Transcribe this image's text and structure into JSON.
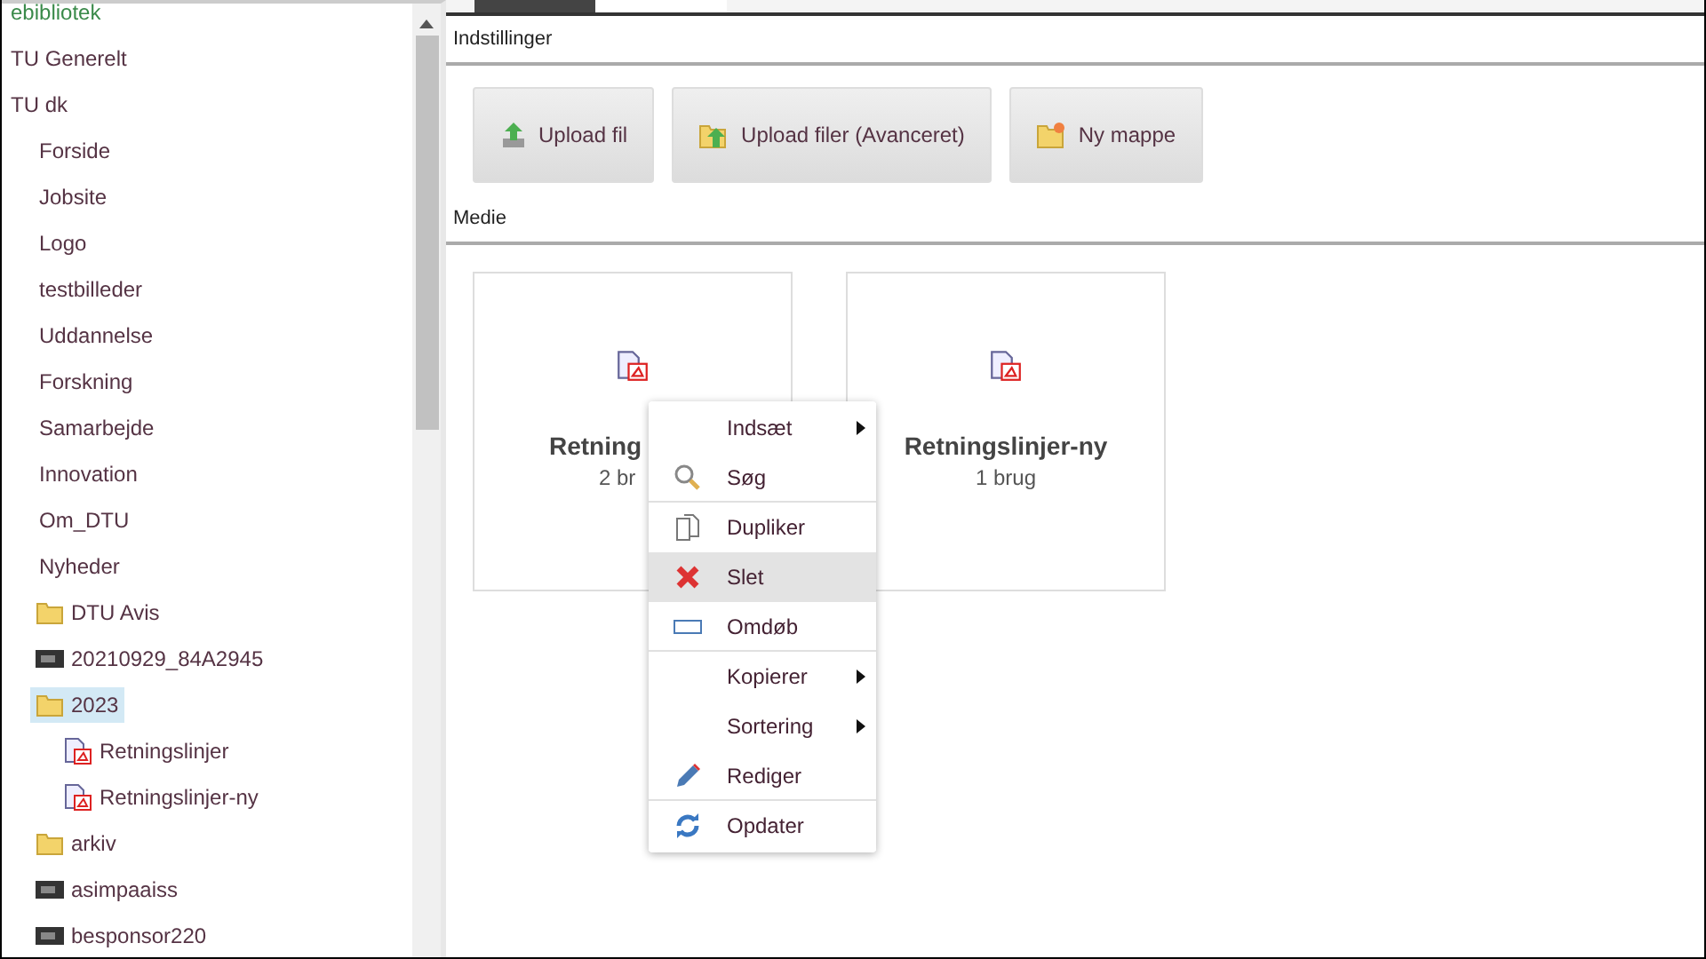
{
  "tree": [
    {
      "label": "ebibliotek",
      "selected": false
    },
    {
      "label": "TU Generelt",
      "selected": false
    },
    {
      "label": "TU dk",
      "selected": false,
      "children": [
        {
          "label": "Forside",
          "selected": false
        },
        {
          "label": "Jobsite",
          "selected": false
        },
        {
          "label": "Logo",
          "selected": false
        },
        {
          "label": "testbilleder",
          "selected": false
        },
        {
          "label": "Uddannelse",
          "selected": false
        },
        {
          "label": "Forskning",
          "selected": false
        },
        {
          "label": "Samarbejde",
          "selected": false
        },
        {
          "label": "Innovation",
          "selected": false
        },
        {
          "label": "Om_DTU",
          "selected": false
        },
        {
          "label": "Nyheder",
          "selected": false
        },
        {
          "label": "DTU Avis",
          "kind": "folder",
          "selected": false
        },
        {
          "label": "20210929_84A2945",
          "kind": "image",
          "selected": false
        },
        {
          "label": "2023",
          "kind": "folder",
          "selected": true,
          "children": [
            {
              "label": "Retningslinjer",
              "kind": "pdf",
              "selected": false
            },
            {
              "label": "Retningslinjer-ny",
              "kind": "pdf",
              "selected": false
            }
          ]
        },
        {
          "label": "arkiv",
          "kind": "folder",
          "selected": false
        },
        {
          "label": "asimpaaiss",
          "kind": "image",
          "selected": false
        },
        {
          "label": "besponsor220",
          "kind": "image",
          "selected": false
        }
      ]
    }
  ],
  "settings_heading": "Indstillinger",
  "buttons": [
    {
      "label": "Upload fil"
    },
    {
      "label": "Upload filer (Avanceret)"
    },
    {
      "label": "Ny mappe"
    }
  ],
  "media_heading": "Medie",
  "media": [
    {
      "title": "Retning",
      "usage": "2 br"
    },
    {
      "title": "Retningslinjer-ny",
      "usage": "1 brug"
    }
  ],
  "context_menu": [
    {
      "label": "Indsæt",
      "submenu": true,
      "separator_after": false,
      "selected": false
    },
    {
      "label": "Søg",
      "submenu": false,
      "separator_after": true,
      "selected": false
    },
    {
      "label": "Dupliker",
      "submenu": false,
      "separator_after": false,
      "selected": false
    },
    {
      "label": "Slet",
      "submenu": false,
      "separator_after": false,
      "selected": true
    },
    {
      "label": "Omdøb",
      "submenu": false,
      "separator_after": true,
      "selected": false
    },
    {
      "label": "Kopierer",
      "submenu": true,
      "separator_after": false,
      "selected": false
    },
    {
      "label": "Sortering",
      "submenu": true,
      "separator_after": false,
      "selected": false
    },
    {
      "label": "Rediger",
      "submenu": false,
      "separator_after": true,
      "selected": false
    },
    {
      "label": "Opdater",
      "submenu": false,
      "separator_after": false,
      "selected": false
    }
  ]
}
